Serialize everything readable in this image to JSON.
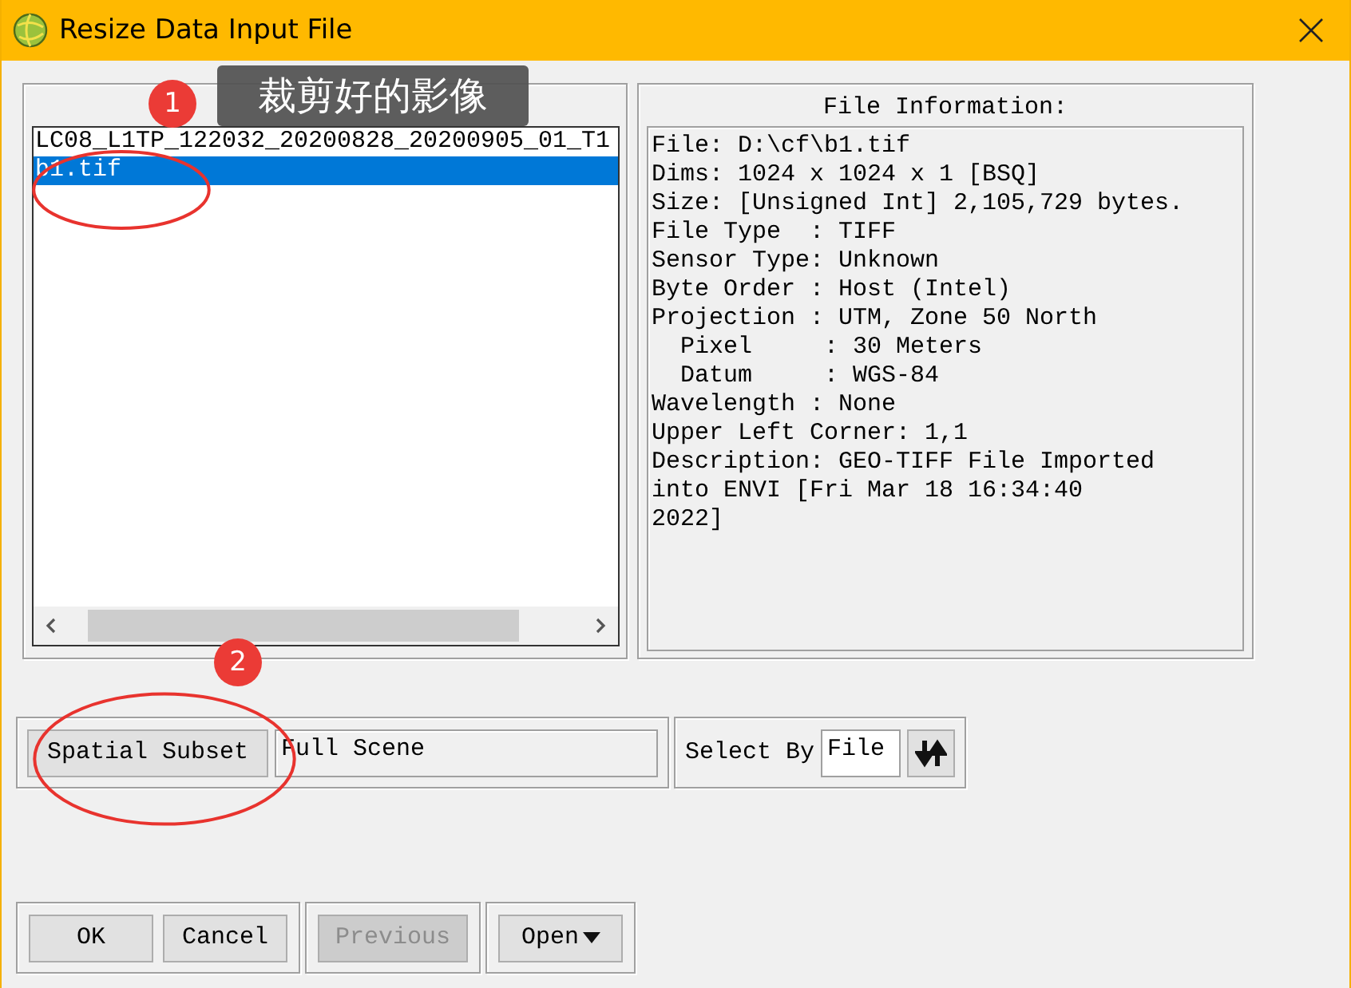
{
  "window": {
    "title": "Resize Data Input File"
  },
  "input_file_list": {
    "items": [
      {
        "name": "LC08_L1TP_122032_20200828_20200905_01_T1",
        "selected": false
      },
      {
        "name": "b1.tif",
        "selected": true
      }
    ]
  },
  "file_information": {
    "title": "File Information:",
    "lines": [
      "File: D:\\cf\\b1.tif",
      "Dims: 1024 x 1024 x 1 [BSQ]",
      "Size: [Unsigned Int] 2,105,729 bytes.",
      "File Type  : TIFF",
      "Sensor Type: Unknown",
      "Byte Order : Host (Intel)",
      "Projection : UTM, Zone 50 North",
      "  Pixel     : 30 Meters",
      "  Datum     : WGS-84",
      "Wavelength : None",
      "Upper Left Corner: 1,1",
      "Description: GEO-TIFF File Imported",
      "into ENVI [Fri Mar 18 16:34:40",
      "2022]"
    ]
  },
  "spatial_subset": {
    "button": "Spatial Subset",
    "value": "Full Scene"
  },
  "select_by": {
    "label": "Select By",
    "value": "File"
  },
  "button_groups": [
    {
      "buttons": [
        {
          "label": "OK",
          "kind": "push",
          "disabled": false
        },
        {
          "label": "Cancel",
          "kind": "push",
          "disabled": false
        }
      ]
    },
    {
      "buttons": [
        {
          "label": "Previous",
          "kind": "push",
          "disabled": true
        }
      ]
    },
    {
      "buttons": [
        {
          "label": "Open",
          "kind": "menu",
          "disabled": false
        }
      ]
    }
  ],
  "callouts": [
    {
      "number": "1",
      "note": "裁剪好的影像"
    },
    {
      "number": "2"
    }
  ]
}
